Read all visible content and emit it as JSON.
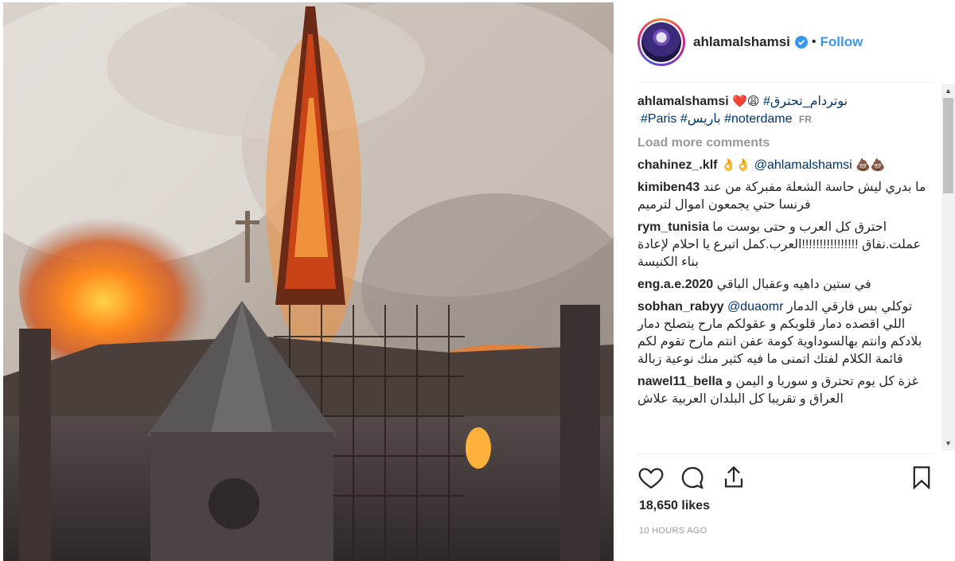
{
  "photo": {
    "description_icon": "notre-dame-fire-photo"
  },
  "header": {
    "username": "ahlamalshamsi",
    "separator": "•",
    "follow_label": "Follow",
    "verified_icon": "verified-badge-icon"
  },
  "caption": {
    "username": "ahlamalshamsi",
    "hashtag1": "#نوتردام_تحترق",
    "emoji": "❤️😩",
    "hashtag2": "#noterdame",
    "hashtag3": "#باريس",
    "hashtag4": "#Paris",
    "translate": "FR"
  },
  "load_more": "Load more comments",
  "comments": [
    {
      "username": "chahinez_.klf",
      "prefix": "👌👌",
      "mention": "@ahlamalshamsi",
      "text": "💩💩"
    },
    {
      "username": "kimiben43",
      "text": "ما بدري ليش حاسة الشعلة مفبركة من عند فرنسا حتي يجمعون اموال لترميم"
    },
    {
      "username": "rym_tunisia",
      "text": "احترق كل العرب و حتى بوست ما عملت.نفاق !!!!!!!!!!!!!!!!العرب.كمل اتبرع يا احلام لإعادة بناء الكنيسة"
    },
    {
      "username": "eng.a.e.2020",
      "text": "في ستين داهيه وعقبال الباقي"
    },
    {
      "username": "sobhan_rabyy",
      "mention": "@duaomr",
      "text": "توكلي بس فارقي الدمار اللي اقصده دمار قلوبكم و عقولكم مارح يتصلح دمار بلادكم وانتم بهالسوداوية كومة عفن انتم مارح تقوم لكم قائمة الكلام لفتك اتمنى ما فيه كثير منك نوعية زبالة"
    },
    {
      "username": "nawel11_bella",
      "text": "غزة كل يوم تحترق و سوريا و اليمن و العراق و تقريبا كل البلدان العربية علاش"
    }
  ],
  "actions": {
    "like_icon": "heart-icon",
    "comment_icon": "comment-icon",
    "share_icon": "share-icon",
    "save_icon": "bookmark-icon"
  },
  "likes": "18,650 likes",
  "time": "10 HOURS AGO",
  "colors": {
    "link": "#003569",
    "follow": "#3897f0",
    "muted": "#999999",
    "text": "#262626"
  }
}
